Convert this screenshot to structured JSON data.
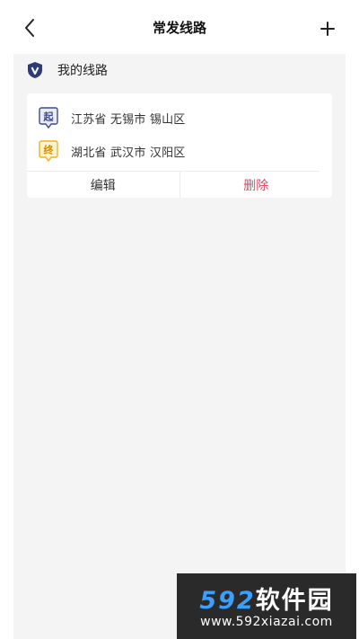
{
  "header": {
    "title": "常发线路",
    "back_icon": "chevron-left-icon",
    "add_icon": "plus-icon"
  },
  "section": {
    "icon": "shield-v-icon",
    "label": "我的线路"
  },
  "route": {
    "start": {
      "badge": "起",
      "address": "江苏省 无锡市 锡山区"
    },
    "end": {
      "badge": "终",
      "address": "湖北省 武汉市 汉阳区"
    },
    "actions": {
      "edit": "编辑",
      "delete": "删除"
    }
  },
  "watermark": {
    "logo_digits": "592",
    "logo_text": "软件园",
    "url": "www.592xiazai.com"
  },
  "colors": {
    "background": "#f4f4f4",
    "card": "#ffffff",
    "start_badge": "#3f4a8a",
    "end_badge": "#f2b21a",
    "delete": "#e6455c"
  }
}
